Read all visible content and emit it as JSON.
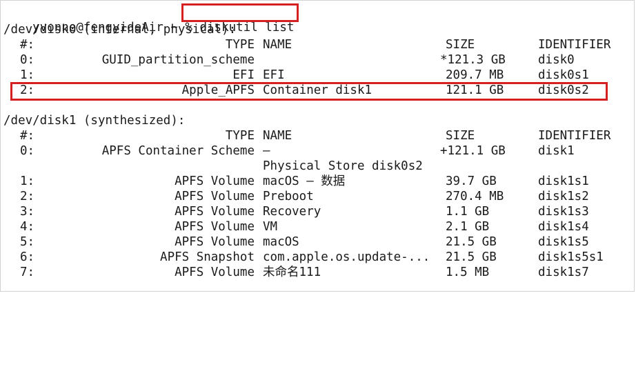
{
  "window": {
    "prompt": "yvonne@fengyideAir ~ % ",
    "command": "diskutil list"
  },
  "disk0": {
    "header": "/dev/disk0 (internal, physical):",
    "columns": {
      "num": "#:",
      "type": "TYPE",
      "name": "NAME",
      "size": "SIZE",
      "identifier": "IDENTIFIER"
    },
    "rows": [
      {
        "num": "0:",
        "type": "GUID_partition_scheme",
        "name": "",
        "size": "*121.3 GB",
        "identifier": "disk0"
      },
      {
        "num": "1:",
        "type": "EFI",
        "name": "EFI",
        "size": "209.7 MB",
        "identifier": "disk0s1"
      },
      {
        "num": "2:",
        "type": "Apple_APFS",
        "name": "Container disk1",
        "size": "121.1 GB",
        "identifier": "disk0s2"
      }
    ]
  },
  "disk1": {
    "header": "/dev/disk1 (synthesized):",
    "columns": {
      "num": "#:",
      "type": "TYPE",
      "name": "NAME",
      "size": "SIZE",
      "identifier": "IDENTIFIER"
    },
    "rows": [
      {
        "num": "0:",
        "type": "APFS Container Scheme",
        "name": "–",
        "size": "+121.1 GB",
        "identifier": "disk1"
      },
      {
        "num": "",
        "type": "",
        "name": "Physical Store disk0s2",
        "size": "",
        "identifier": ""
      },
      {
        "num": "1:",
        "type": "APFS Volume",
        "name": "macOS – 数据",
        "size": "39.7 GB",
        "identifier": "disk1s1"
      },
      {
        "num": "2:",
        "type": "APFS Volume",
        "name": "Preboot",
        "size": "270.4 MB",
        "identifier": "disk1s2"
      },
      {
        "num": "3:",
        "type": "APFS Volume",
        "name": "Recovery",
        "size": "1.1 GB",
        "identifier": "disk1s3"
      },
      {
        "num": "4:",
        "type": "APFS Volume",
        "name": "VM",
        "size": "2.1 GB",
        "identifier": "disk1s4"
      },
      {
        "num": "5:",
        "type": "APFS Volume",
        "name": "macOS",
        "size": "21.5 GB",
        "identifier": "disk1s5"
      },
      {
        "num": "6:",
        "type": "APFS Snapshot",
        "name": "com.apple.os.update-...",
        "size": "21.5 GB",
        "identifier": "disk1s5s1"
      },
      {
        "num": "7:",
        "type": "APFS Volume",
        "name": "未命名111",
        "size": "1.5 MB",
        "identifier": "disk1s7"
      }
    ]
  },
  "colors": {
    "highlight": "#d42020",
    "text": "#1a1a1a",
    "background": "#ffffff"
  }
}
